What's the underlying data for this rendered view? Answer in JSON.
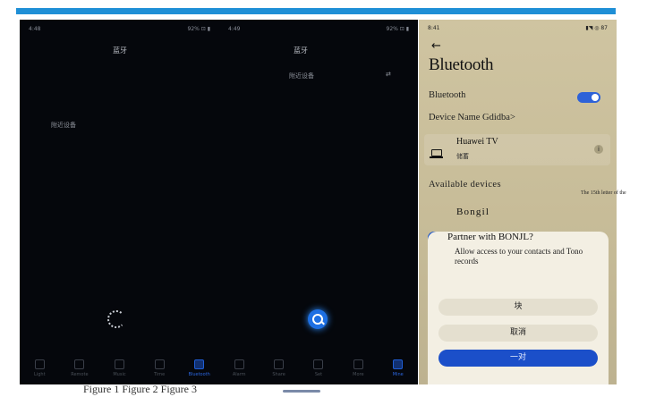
{
  "screen1": {
    "status_left": "4:48",
    "status_right": "92% ⊡ ▮",
    "title": "蓝牙",
    "section_label": "附近设备",
    "bottom_nav": [
      "Light",
      "Remote",
      "Music",
      "Time",
      "Bluetooth"
    ]
  },
  "screen2": {
    "status_left": "4:49",
    "status_right": "92% ⊡ ▮",
    "title": "蓝牙",
    "subtitle": "附近设备",
    "top_icon": "⇄",
    "bottom_nav": [
      "Alarm",
      "Share",
      "Set",
      "More",
      "Mine"
    ]
  },
  "screen3": {
    "status_left": "8:41",
    "status_right": "▮◥ ◎ 87",
    "back_icon": "←",
    "title": "Bluetooth",
    "bluetooth_label": "Bluetooth",
    "bluetooth_on": true,
    "device_name_label": "Device Name Gdidba>",
    "paired_device": {
      "name": "Huawei TV",
      "status": "储蓄",
      "info_icon": "i"
    },
    "available_label": "Available devices",
    "available_device": "Bongil",
    "dialog": {
      "title": "Partner with BONJL?",
      "message": "Allow access to your contacts and Tono records",
      "btn1": "块",
      "btn2": "取消",
      "btn3": "一对"
    }
  },
  "side_caption": "The 15th letter of the",
  "caption": "Figure 1  Figure 2  Figure 3",
  "colors": {
    "accent": "#1f8fd6",
    "toggle": "#2e62d8",
    "dialog_primary": "#1b4fc9",
    "panel_bg": "#cfc4a1"
  }
}
